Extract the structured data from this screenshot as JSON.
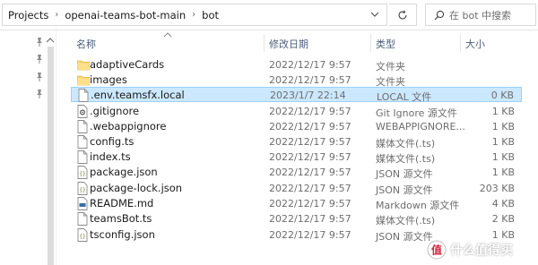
{
  "address_bar": {
    "breadcrumbs": [
      "Projects",
      "openai-teams-bot-main",
      "bot"
    ],
    "search_placeholder": "在 bot 中搜索"
  },
  "columns": {
    "name": "名称",
    "date": "修改日期",
    "type": "类型",
    "size": "大小"
  },
  "files": [
    {
      "name": "adaptiveCards",
      "date": "2022/12/17 9:57",
      "type": "文件夹",
      "size": "",
      "icon": "folder-icon",
      "selected": false
    },
    {
      "name": "images",
      "date": "2022/12/17 9:57",
      "type": "文件夹",
      "size": "",
      "icon": "folder-icon",
      "selected": false
    },
    {
      "name": ".env.teamsfx.local",
      "date": "2023/1/7 22:14",
      "type": "LOCAL 文件",
      "size": "0 KB",
      "icon": "file-icon",
      "selected": true
    },
    {
      "name": ".gitignore",
      "date": "2022/12/17 9:57",
      "type": "Git Ignore 源文件",
      "size": "1 KB",
      "icon": "gear-file-icon",
      "selected": false
    },
    {
      "name": ".webappignore",
      "date": "2022/12/17 9:57",
      "type": "WEBAPPIGNORE...",
      "size": "1 KB",
      "icon": "file-icon",
      "selected": false
    },
    {
      "name": "config.ts",
      "date": "2022/12/17 9:57",
      "type": "媒体文件(.ts)",
      "size": "1 KB",
      "icon": "file-icon",
      "selected": false
    },
    {
      "name": "index.ts",
      "date": "2022/12/17 9:57",
      "type": "媒体文件(.ts)",
      "size": "1 KB",
      "icon": "file-icon",
      "selected": false
    },
    {
      "name": "package.json",
      "date": "2022/12/17 9:57",
      "type": "JSON 源文件",
      "size": "1 KB",
      "icon": "json-file-icon",
      "selected": false
    },
    {
      "name": "package-lock.json",
      "date": "2022/12/17 9:57",
      "type": "JSON 源文件",
      "size": "203 KB",
      "icon": "json-file-icon",
      "selected": false
    },
    {
      "name": "README.md",
      "date": "2022/12/17 9:57",
      "type": "Markdown 源文件",
      "size": "4 KB",
      "icon": "markdown-file-icon",
      "selected": false
    },
    {
      "name": "teamsBot.ts",
      "date": "2022/12/17 9:57",
      "type": "媒体文件(.ts)",
      "size": "2 KB",
      "icon": "file-icon",
      "selected": false
    },
    {
      "name": "tsconfig.json",
      "date": "2022/12/17 9:57",
      "type": "JSON 源文件",
      "size": "1 KB",
      "icon": "json-file-icon",
      "selected": false
    }
  ],
  "watermark": {
    "text": "什么值得买"
  },
  "colors": {
    "selection": "#cce8ff",
    "selection_border": "#99d1ff",
    "folder": "#f8d775",
    "header_text": "#4c607a"
  }
}
